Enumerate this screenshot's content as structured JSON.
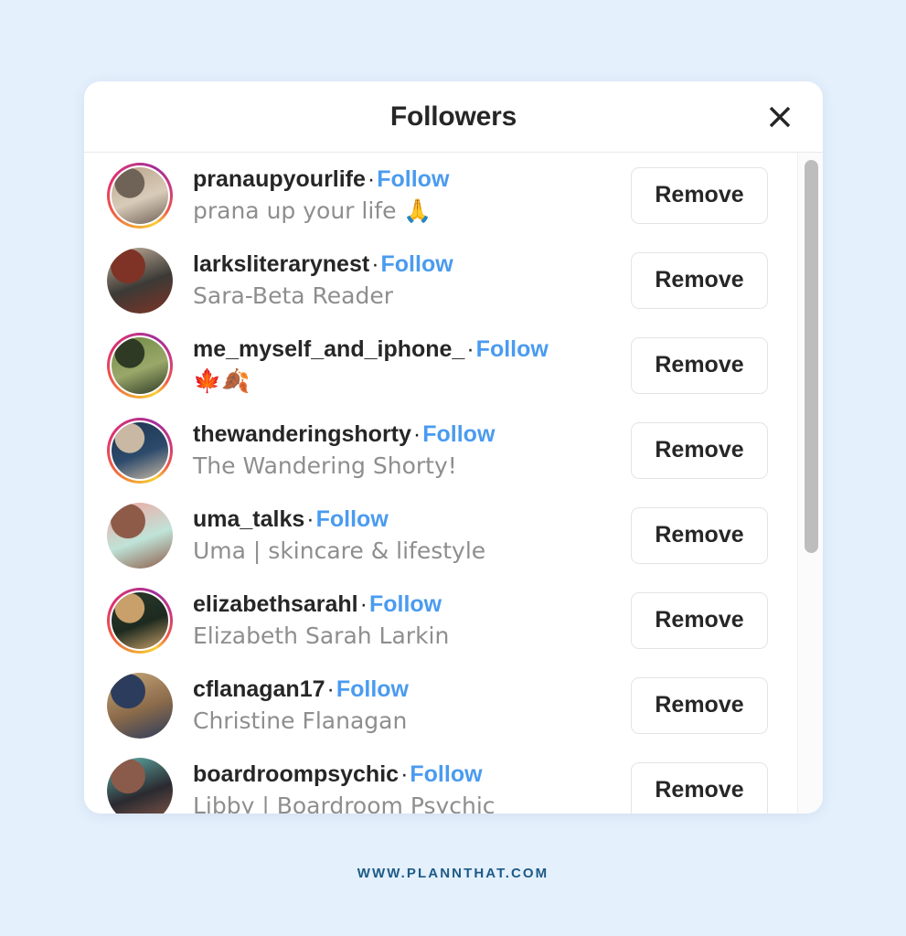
{
  "background_color": "#e4f0fc",
  "modal": {
    "title": "Followers",
    "close_icon": "close-x-icon",
    "accent_blue": "#4a9bf0",
    "username_color": "#262626",
    "subtitle_color": "#8e8e8e",
    "separator_dot": "·",
    "follow_label": "Follow",
    "remove_label": "Remove",
    "followers": [
      {
        "username": "pranaupyourlife",
        "follow_label": "Follow",
        "fullname": "prana up your life 🙏",
        "remove_label": "Remove",
        "has_story_ring": true,
        "avatar_colors": [
          "#b9a48c",
          "#6f6257",
          "#d8cbb8"
        ]
      },
      {
        "username": "larksliterarynest",
        "follow_label": "Follow",
        "fullname": "Sara-Beta Reader",
        "remove_label": "Remove",
        "has_story_ring": false,
        "avatar_colors": [
          "#c9b49e",
          "#7e3326",
          "#3c3a36"
        ]
      },
      {
        "username": "me_myself_and_iphone_",
        "follow_label": "Follow",
        "fullname": "🍁🍂",
        "remove_label": "Remove",
        "has_story_ring": true,
        "avatar_colors": [
          "#6f8a46",
          "#2f3a24",
          "#9aa86a"
        ]
      },
      {
        "username": "thewanderingshorty",
        "follow_label": "Follow",
        "fullname": "The Wandering Shorty!",
        "remove_label": "Remove",
        "has_story_ring": true,
        "avatar_colors": [
          "#1d3551",
          "#c9b9a4",
          "#2c4a6b"
        ]
      },
      {
        "username": "uma_talks",
        "follow_label": "Follow",
        "fullname": "Uma | skincare & lifestyle",
        "remove_label": "Remove",
        "has_story_ring": false,
        "avatar_colors": [
          "#f2a6a0",
          "#8d5b48",
          "#bfe3d8"
        ]
      },
      {
        "username": "elizabethsarahl",
        "follow_label": "Follow",
        "fullname": "Elizabeth Sarah Larkin",
        "remove_label": "Remove",
        "has_story_ring": true,
        "avatar_colors": [
          "#2c3a2e",
          "#c9a06a",
          "#1d2a1f"
        ]
      },
      {
        "username": "cflanagan17",
        "follow_label": "Follow",
        "fullname": "Christine Flanagan",
        "remove_label": "Remove",
        "has_story_ring": false,
        "avatar_colors": [
          "#c8a878",
          "#2c3c5c",
          "#8a6a4a"
        ]
      },
      {
        "username": "boardroompsychic",
        "follow_label": "Follow",
        "fullname": "Libby | Boardroom Psychic",
        "remove_label": "Remove",
        "has_story_ring": false,
        "avatar_colors": [
          "#62b3ac",
          "#8a5a4a",
          "#2a2a30"
        ]
      }
    ]
  },
  "scrollbar": {
    "name": "followers-scrollbar"
  },
  "footer": {
    "url": "WWW.PLANNTHAT.COM",
    "color": "#1d5a86"
  }
}
